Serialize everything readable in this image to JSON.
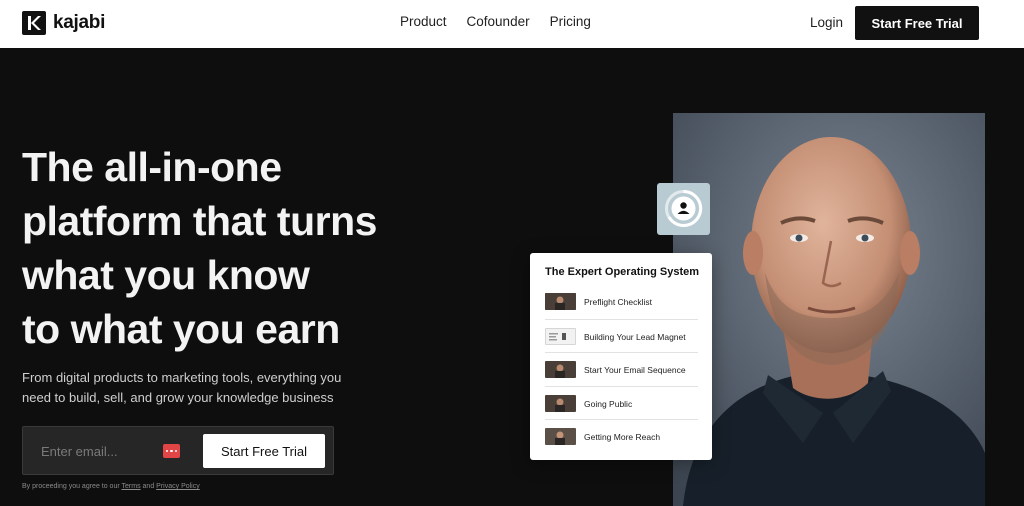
{
  "nav": {
    "brand": "kajabi",
    "links": [
      "Product",
      "Cofounder",
      "Pricing"
    ],
    "login": "Login",
    "cta": "Start Free Trial"
  },
  "hero": {
    "title_lines": [
      "The all-in-one",
      "platform that turns",
      "what you know",
      "to what you earn"
    ],
    "subtitle_lines": [
      "From digital products to marketing tools, everything you",
      "need to build, sell, and grow your knowledge business"
    ],
    "email_placeholder": "Enter email...",
    "cta": "Start Free Trial",
    "legal": {
      "prefix": "By proceeding you agree to our",
      "terms": "Terms",
      "and": "and",
      "privacy": "Privacy Policy"
    }
  },
  "course_card": {
    "title": "The Expert Operating System",
    "lessons": [
      {
        "name": "Preflight Checklist",
        "thumb_icon": "video-thumbnail"
      },
      {
        "name": "Building Your Lead Magnet",
        "thumb_icon": "document-thumbnail"
      },
      {
        "name": "Start Your Email Sequence",
        "thumb_icon": "video-thumbnail"
      },
      {
        "name": "Going Public",
        "thumb_icon": "video-thumbnail"
      },
      {
        "name": "Getting More Reach",
        "thumb_icon": "video-thumbnail"
      }
    ]
  },
  "colors": {
    "background": "#0e0e0e",
    "nav_bg": "#ffffff",
    "accent_red": "#e24545",
    "avatar_card": "#b9cbd2"
  }
}
